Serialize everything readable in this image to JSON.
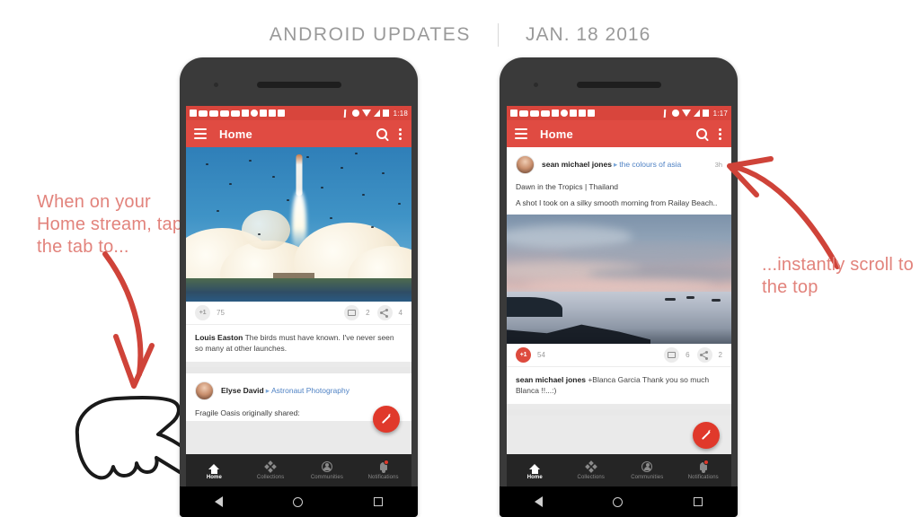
{
  "header": {
    "title": "ANDROID UPDATES",
    "date": "JAN. 18 2016"
  },
  "annotations": {
    "left": "When on your Home stream, tap the tab to...",
    "right": "...instantly scroll to the top",
    "left_arrow_icon": "curved-down-arrow-icon",
    "right_arrow_icon": "curved-up-left-arrow-icon",
    "hand_icon": "pointing-hand-cursor-icon"
  },
  "phones": [
    {
      "id": "left",
      "statusbar": {
        "time": "1:18",
        "notification_icons": [
          "calendar-icon",
          "mail-icon",
          "photos-icon",
          "chat-icon",
          "link-icon",
          "phone-icon",
          "circle-icon",
          "square-icon",
          "sync-icon",
          "app-icon"
        ],
        "system_icons": [
          "bluetooth-icon",
          "dnd-icon",
          "wifi-icon",
          "signal-icon",
          "battery-icon"
        ]
      },
      "appbar": {
        "menu_icon": "hamburger-icon",
        "title": "Home",
        "search_icon": "search-icon",
        "overflow_icon": "kebab-menu-icon"
      },
      "post": {
        "image_alt": "space-shuttle-launch-photo",
        "plus_one_label": "+1",
        "plus_one_count": "75",
        "plus_one_active": false,
        "comment_count": "2",
        "share_count": "4",
        "comment_author": "Louis Easton",
        "comment_text": " The birds must have known. I've never seen so many at other launches."
      },
      "next_post": {
        "author": "Elyse David",
        "arrow": "▸",
        "collection": "Astronaut Photography",
        "share_line": "Fragile Oasis originally shared:"
      },
      "fab_icon": "compose-pencil-icon",
      "tabs": [
        {
          "label": "Home",
          "icon": "home-icon",
          "active": true,
          "badge": false
        },
        {
          "label": "Collections",
          "icon": "collections-icon",
          "active": false,
          "badge": false
        },
        {
          "label": "Communities",
          "icon": "communities-icon",
          "active": false,
          "badge": false
        },
        {
          "label": "Notifications",
          "icon": "bell-icon",
          "active": false,
          "badge": true
        }
      ],
      "softkeys": [
        "back-icon",
        "home-icon",
        "recents-icon"
      ]
    },
    {
      "id": "right",
      "statusbar": {
        "time": "1:17",
        "notification_icons": [
          "calendar-icon",
          "mail-icon",
          "chat-icon",
          "link-icon",
          "phone-icon",
          "circle-icon",
          "square-icon",
          "gplus-icon",
          "app-icon"
        ],
        "system_icons": [
          "bluetooth-icon",
          "dnd-icon",
          "wifi-icon",
          "signal-icon",
          "battery-icon"
        ]
      },
      "appbar": {
        "menu_icon": "hamburger-icon",
        "title": "Home",
        "search_icon": "search-icon",
        "overflow_icon": "kebab-menu-icon"
      },
      "post": {
        "author": "sean michael jones",
        "arrow": "▸",
        "collection": "the colours of asia",
        "age": "3h",
        "title_line": "Dawn in the Tropics | Thailand",
        "body_line": "A shot I took on a silky smooth morning from Railay Beach..",
        "image_alt": "tropical-dawn-seascape-photo",
        "plus_one_label": "+1",
        "plus_one_count": "54",
        "plus_one_active": true,
        "comment_count": "6",
        "share_count": "2",
        "comment_author": "sean michael jones",
        "comment_text": " +Blanca Garcia Thank you so much Blanca !!...:)"
      },
      "fab_icon": "compose-pencil-icon",
      "tabs": [
        {
          "label": "Home",
          "icon": "home-icon",
          "active": true,
          "badge": false
        },
        {
          "label": "Collections",
          "icon": "collections-icon",
          "active": false,
          "badge": false
        },
        {
          "label": "Communities",
          "icon": "communities-icon",
          "active": false,
          "badge": false
        },
        {
          "label": "Notifications",
          "icon": "bell-icon",
          "active": false,
          "badge": true
        }
      ],
      "softkeys": [
        "back-icon",
        "home-icon",
        "recents-icon"
      ]
    }
  ],
  "colors": {
    "app_red": "#e04b42",
    "status_red": "#d8453c",
    "accent_red": "#e0392b",
    "annotation_pink": "#e2837c",
    "header_gray": "#9a9a9a",
    "link_blue": "#4f82c4"
  }
}
